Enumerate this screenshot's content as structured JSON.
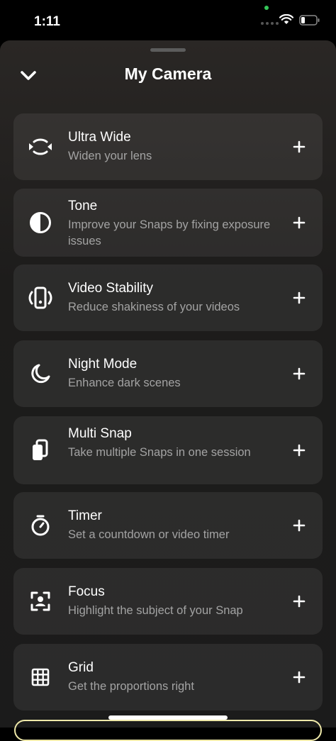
{
  "status": {
    "time": "1:11"
  },
  "sheet": {
    "title": "My Camera"
  },
  "items": [
    {
      "label": "Ultra Wide",
      "desc": "Widen your lens",
      "icon": "ultra-wide-icon"
    },
    {
      "label": "Tone",
      "desc": "Improve your Snaps by fixing exposure issues",
      "icon": "tone-icon"
    },
    {
      "label": "Video Stability",
      "desc": "Reduce shakiness of your videos",
      "icon": "video-stability-icon"
    },
    {
      "label": "Night Mode",
      "desc": "Enhance dark scenes",
      "icon": "moon-icon"
    },
    {
      "label": "Multi Snap",
      "desc": "Take multiple Snaps in one session",
      "icon": "multi-snap-icon"
    },
    {
      "label": "Timer",
      "desc": "Set a countdown or video timer",
      "icon": "timer-icon"
    },
    {
      "label": "Focus",
      "desc": "Highlight the subject of your Snap",
      "icon": "focus-icon"
    },
    {
      "label": "Grid",
      "desc": "Get the proportions right",
      "icon": "grid-icon"
    }
  ],
  "colors": {
    "accent_outline": "#efe9a9",
    "status_dot": "#35c759"
  }
}
